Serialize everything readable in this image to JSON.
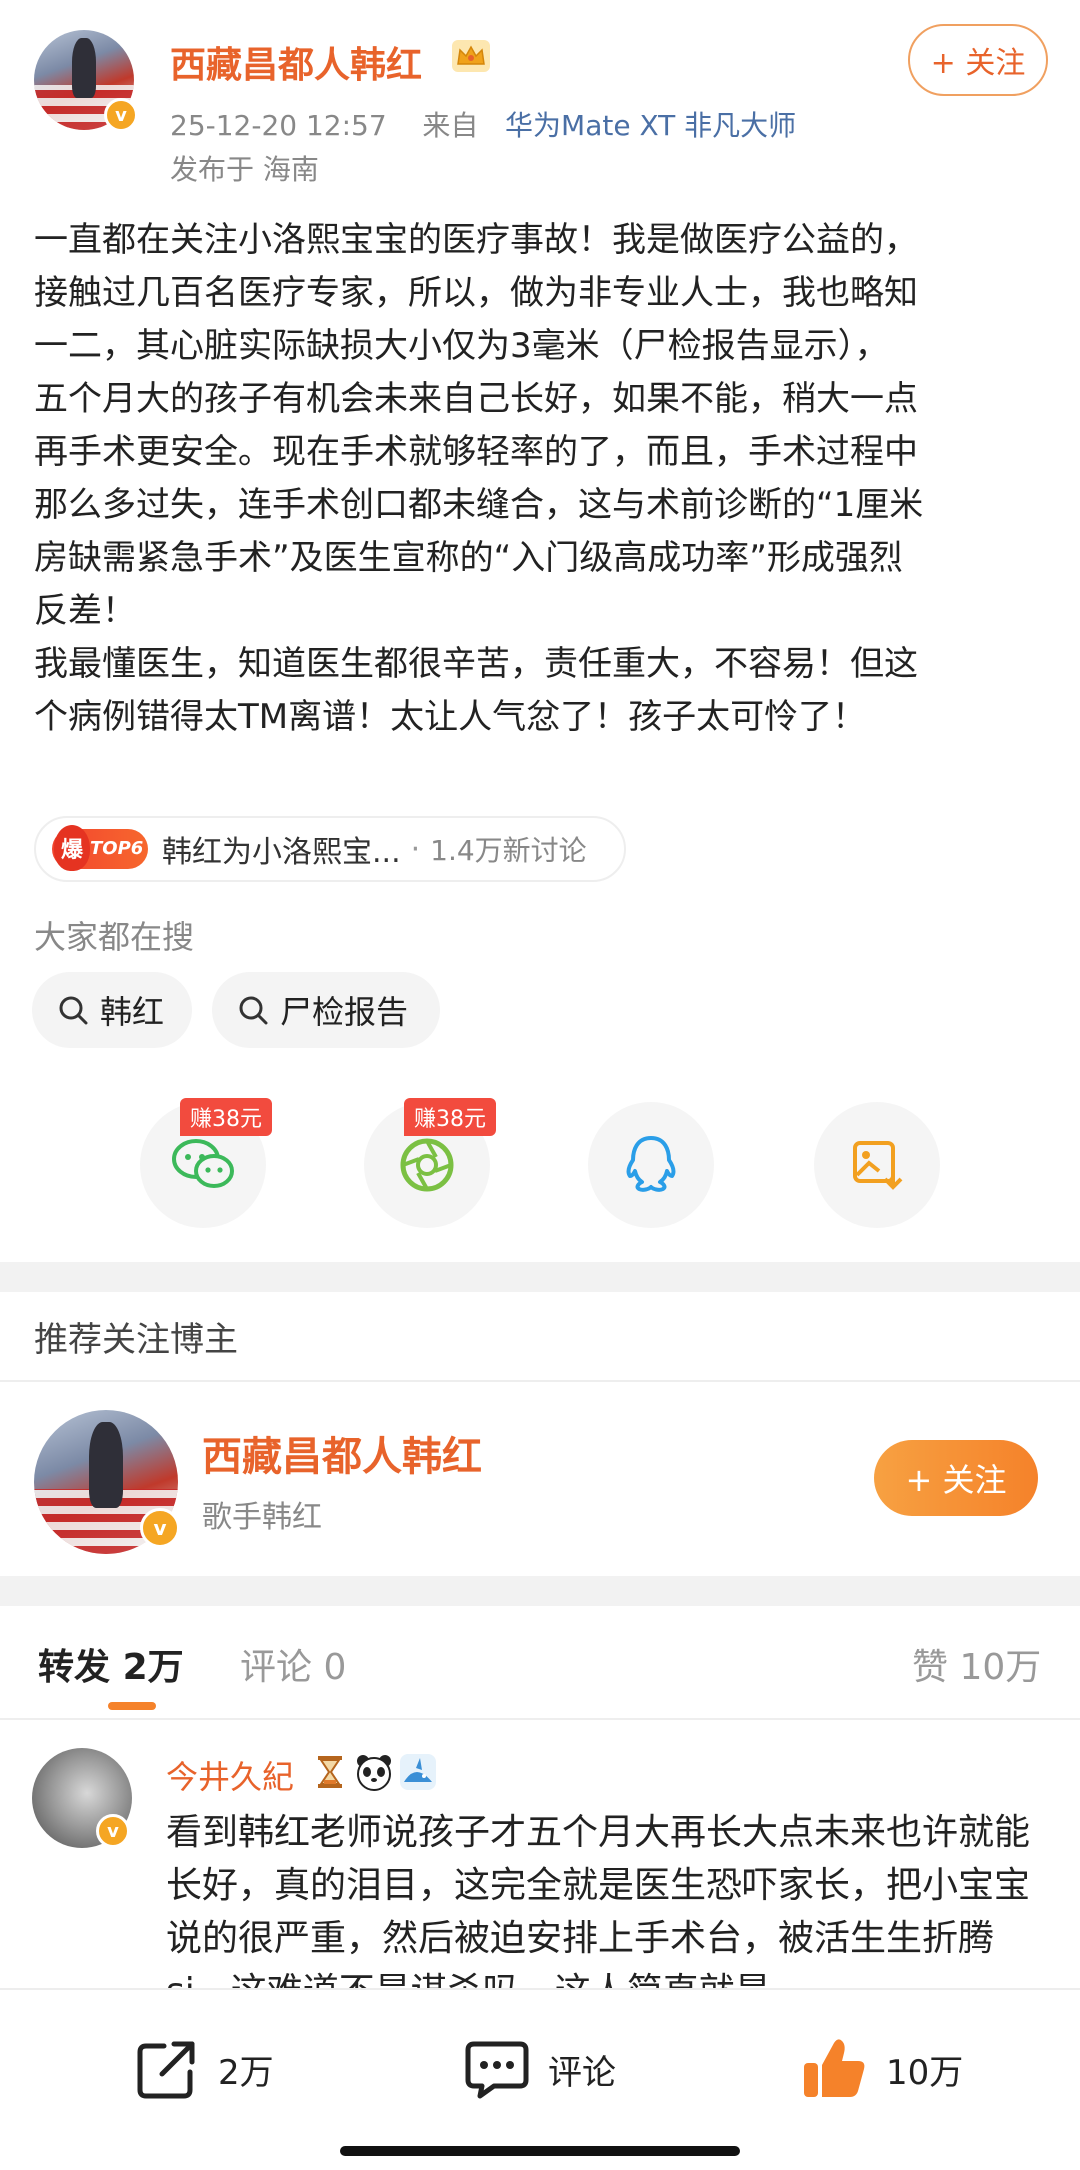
{
  "post": {
    "author": "西藏昌都人韩红",
    "verified_mark": "v",
    "follow_label": "+ 关注",
    "timestamp": "25-12-20 12:57",
    "from_prefix": "来自",
    "device": "华为Mate XT 非凡大师",
    "location": "发布于 海南",
    "body": "一直都在关注小洛熙宝宝的医疗事故！我是做医疗公益的，\n接触过几百名医疗专家，所以，做为非专业人士，我也略知\n一二，其心脏实际缺损大小仅为3毫米（尸检报告显示），\n五个月大的孩子有机会未来自己长好，如果不能，稍大一点\n再手术更安全。现在手术就够轻率的了，而且，手术过程中\n那么多过失，连手术创口都未缝合，这与术前诊断的“1厘米\n房缺需紧急手术”及医生宣称的“入门级高成功率”形成强烈\n反差！\n我最懂医生，知道医生都很辛苦，责任重大，不容易！但这\n个病例错得太TM离谱！太让人气忿了！孩子太可怜了！"
  },
  "topic": {
    "hot_char": "爆",
    "rank": "TOP6",
    "text": "韩红为小洛熙宝...",
    "dot": "·",
    "count": "1.4万新讨论"
  },
  "search": {
    "label": "大家都在搜",
    "chips": [
      "韩红",
      "尸检报告"
    ]
  },
  "share": {
    "items": [
      {
        "icon": "wechat-icon",
        "reward": "赚38元"
      },
      {
        "icon": "moments-icon",
        "reward": "赚38元"
      },
      {
        "icon": "qq-icon"
      },
      {
        "icon": "save-image-icon"
      }
    ]
  },
  "recommend": {
    "title": "推荐关注博主",
    "name": "西藏昌都人韩红",
    "desc": "歌手韩红",
    "follow_label": "+ 关注"
  },
  "tabs": {
    "repost_label": "转发",
    "repost_count": "2万",
    "comment_label": "评论",
    "comment_count": "0",
    "like_label": "赞",
    "like_count": "10万"
  },
  "comment": {
    "user": "今井久紀",
    "text": "看到韩红老师说孩子才五个月大再长大点未来也许就能长好，真的泪目，这完全就是医生恐吓家长，把小宝宝说的很严重，然后被迫安排上手术台，被活生生折腾si，这难道不是谋杀吗，这人简直就是"
  },
  "bottom_bar": {
    "repost": "2万",
    "comment": "评论",
    "like": "10万"
  },
  "colors": {
    "accent": "#e8632b",
    "follow_gradient": "#f5822a",
    "reward": "#f24b3e",
    "link_blue": "#4a6fa5"
  }
}
